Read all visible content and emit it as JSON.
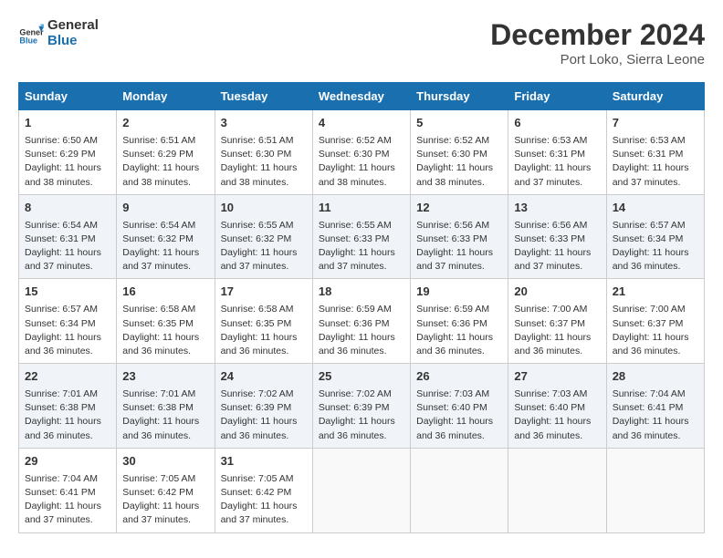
{
  "header": {
    "logo_line1": "General",
    "logo_line2": "Blue",
    "month": "December 2024",
    "location": "Port Loko, Sierra Leone"
  },
  "weekdays": [
    "Sunday",
    "Monday",
    "Tuesday",
    "Wednesday",
    "Thursday",
    "Friday",
    "Saturday"
  ],
  "weeks": [
    [
      {
        "day": "1",
        "lines": [
          "Sunrise: 6:50 AM",
          "Sunset: 6:29 PM",
          "Daylight: 11 hours",
          "and 38 minutes."
        ]
      },
      {
        "day": "2",
        "lines": [
          "Sunrise: 6:51 AM",
          "Sunset: 6:29 PM",
          "Daylight: 11 hours",
          "and 38 minutes."
        ]
      },
      {
        "day": "3",
        "lines": [
          "Sunrise: 6:51 AM",
          "Sunset: 6:30 PM",
          "Daylight: 11 hours",
          "and 38 minutes."
        ]
      },
      {
        "day": "4",
        "lines": [
          "Sunrise: 6:52 AM",
          "Sunset: 6:30 PM",
          "Daylight: 11 hours",
          "and 38 minutes."
        ]
      },
      {
        "day": "5",
        "lines": [
          "Sunrise: 6:52 AM",
          "Sunset: 6:30 PM",
          "Daylight: 11 hours",
          "and 38 minutes."
        ]
      },
      {
        "day": "6",
        "lines": [
          "Sunrise: 6:53 AM",
          "Sunset: 6:31 PM",
          "Daylight: 11 hours",
          "and 37 minutes."
        ]
      },
      {
        "day": "7",
        "lines": [
          "Sunrise: 6:53 AM",
          "Sunset: 6:31 PM",
          "Daylight: 11 hours",
          "and 37 minutes."
        ]
      }
    ],
    [
      {
        "day": "8",
        "lines": [
          "Sunrise: 6:54 AM",
          "Sunset: 6:31 PM",
          "Daylight: 11 hours",
          "and 37 minutes."
        ]
      },
      {
        "day": "9",
        "lines": [
          "Sunrise: 6:54 AM",
          "Sunset: 6:32 PM",
          "Daylight: 11 hours",
          "and 37 minutes."
        ]
      },
      {
        "day": "10",
        "lines": [
          "Sunrise: 6:55 AM",
          "Sunset: 6:32 PM",
          "Daylight: 11 hours",
          "and 37 minutes."
        ]
      },
      {
        "day": "11",
        "lines": [
          "Sunrise: 6:55 AM",
          "Sunset: 6:33 PM",
          "Daylight: 11 hours",
          "and 37 minutes."
        ]
      },
      {
        "day": "12",
        "lines": [
          "Sunrise: 6:56 AM",
          "Sunset: 6:33 PM",
          "Daylight: 11 hours",
          "and 37 minutes."
        ]
      },
      {
        "day": "13",
        "lines": [
          "Sunrise: 6:56 AM",
          "Sunset: 6:33 PM",
          "Daylight: 11 hours",
          "and 37 minutes."
        ]
      },
      {
        "day": "14",
        "lines": [
          "Sunrise: 6:57 AM",
          "Sunset: 6:34 PM",
          "Daylight: 11 hours",
          "and 36 minutes."
        ]
      }
    ],
    [
      {
        "day": "15",
        "lines": [
          "Sunrise: 6:57 AM",
          "Sunset: 6:34 PM",
          "Daylight: 11 hours",
          "and 36 minutes."
        ]
      },
      {
        "day": "16",
        "lines": [
          "Sunrise: 6:58 AM",
          "Sunset: 6:35 PM",
          "Daylight: 11 hours",
          "and 36 minutes."
        ]
      },
      {
        "day": "17",
        "lines": [
          "Sunrise: 6:58 AM",
          "Sunset: 6:35 PM",
          "Daylight: 11 hours",
          "and 36 minutes."
        ]
      },
      {
        "day": "18",
        "lines": [
          "Sunrise: 6:59 AM",
          "Sunset: 6:36 PM",
          "Daylight: 11 hours",
          "and 36 minutes."
        ]
      },
      {
        "day": "19",
        "lines": [
          "Sunrise: 6:59 AM",
          "Sunset: 6:36 PM",
          "Daylight: 11 hours",
          "and 36 minutes."
        ]
      },
      {
        "day": "20",
        "lines": [
          "Sunrise: 7:00 AM",
          "Sunset: 6:37 PM",
          "Daylight: 11 hours",
          "and 36 minutes."
        ]
      },
      {
        "day": "21",
        "lines": [
          "Sunrise: 7:00 AM",
          "Sunset: 6:37 PM",
          "Daylight: 11 hours",
          "and 36 minutes."
        ]
      }
    ],
    [
      {
        "day": "22",
        "lines": [
          "Sunrise: 7:01 AM",
          "Sunset: 6:38 PM",
          "Daylight: 11 hours",
          "and 36 minutes."
        ]
      },
      {
        "day": "23",
        "lines": [
          "Sunrise: 7:01 AM",
          "Sunset: 6:38 PM",
          "Daylight: 11 hours",
          "and 36 minutes."
        ]
      },
      {
        "day": "24",
        "lines": [
          "Sunrise: 7:02 AM",
          "Sunset: 6:39 PM",
          "Daylight: 11 hours",
          "and 36 minutes."
        ]
      },
      {
        "day": "25",
        "lines": [
          "Sunrise: 7:02 AM",
          "Sunset: 6:39 PM",
          "Daylight: 11 hours",
          "and 36 minutes."
        ]
      },
      {
        "day": "26",
        "lines": [
          "Sunrise: 7:03 AM",
          "Sunset: 6:40 PM",
          "Daylight: 11 hours",
          "and 36 minutes."
        ]
      },
      {
        "day": "27",
        "lines": [
          "Sunrise: 7:03 AM",
          "Sunset: 6:40 PM",
          "Daylight: 11 hours",
          "and 36 minutes."
        ]
      },
      {
        "day": "28",
        "lines": [
          "Sunrise: 7:04 AM",
          "Sunset: 6:41 PM",
          "Daylight: 11 hours",
          "and 36 minutes."
        ]
      }
    ],
    [
      {
        "day": "29",
        "lines": [
          "Sunrise: 7:04 AM",
          "Sunset: 6:41 PM",
          "Daylight: 11 hours",
          "and 37 minutes."
        ]
      },
      {
        "day": "30",
        "lines": [
          "Sunrise: 7:05 AM",
          "Sunset: 6:42 PM",
          "Daylight: 11 hours",
          "and 37 minutes."
        ]
      },
      {
        "day": "31",
        "lines": [
          "Sunrise: 7:05 AM",
          "Sunset: 6:42 PM",
          "Daylight: 11 hours",
          "and 37 minutes."
        ]
      },
      null,
      null,
      null,
      null
    ]
  ]
}
